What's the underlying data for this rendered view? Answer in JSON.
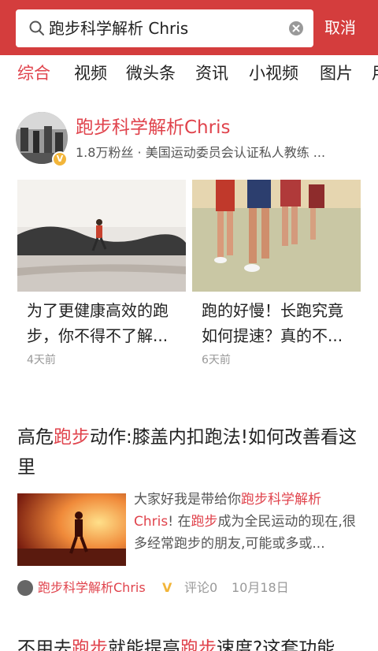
{
  "search": {
    "query": "跑步科学解析 Chris",
    "cancel_label": "取消"
  },
  "tabs": [
    {
      "label": "综合",
      "active": true
    },
    {
      "label": "视频",
      "active": false
    },
    {
      "label": "微头条",
      "active": false
    },
    {
      "label": "资讯",
      "active": false
    },
    {
      "label": "小视频",
      "active": false
    },
    {
      "label": "图片",
      "active": false
    },
    {
      "label": "用",
      "active": false
    }
  ],
  "account": {
    "name": "跑步科学解析Chris",
    "meta": "1.8万粉丝 · 美国运动委员会认证私人教练 ..."
  },
  "videos": [
    {
      "title": "为了更健康高效的跑步，你不得不了解...",
      "time": "4天前"
    },
    {
      "title": "跑的好慢！长跑究竟如何提速？真的不...",
      "time": "6天前"
    }
  ],
  "article": {
    "title_parts": [
      "高危",
      "跑步",
      "动作:膝盖内扣跑法!如何改善看这里"
    ],
    "summary_parts": [
      "大家好我是带给你",
      "跑步科学解析",
      " ",
      "Chris",
      "! 在",
      "跑步",
      "成为全民运动的现在,很多经常跑步的朋友,可能或多或..."
    ],
    "source": "跑步科学解析Chris",
    "verified": "V",
    "comments": "评论0",
    "date": "10月18日"
  },
  "article2": {
    "title_parts": [
      "不用去",
      "跑步",
      "就能提高",
      "跑步",
      "速度?这套功能"
    ]
  },
  "colors": {
    "brand_red": "#d43d3d",
    "highlight": "#e0434c",
    "verified": "#f2b53a"
  },
  "icons": {
    "search": "search-icon",
    "clear": "clear-icon"
  }
}
